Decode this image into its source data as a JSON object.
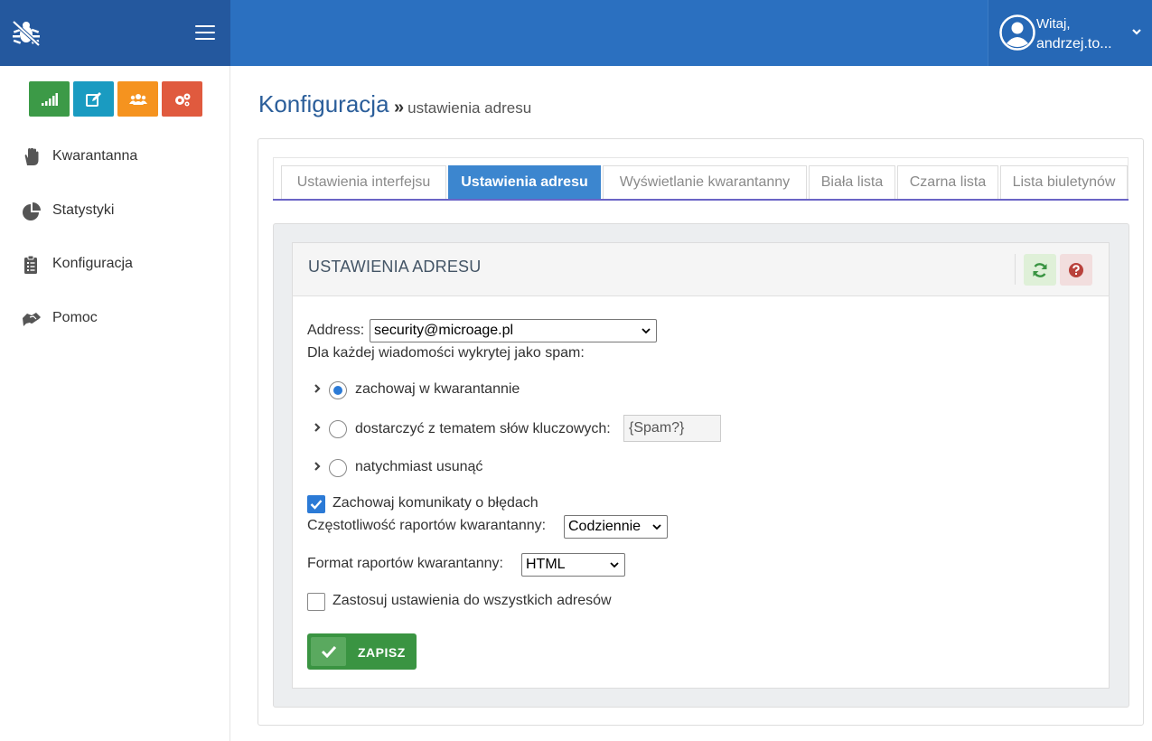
{
  "header": {
    "brand_icon": "bug-off-icon",
    "menu_icon": "hamburger-icon",
    "user": {
      "greeting": "Witaj,",
      "name": "andrzej.to...",
      "avatar_icon": "user-circle-icon",
      "caret_icon": "chevron-down-icon"
    }
  },
  "sidebar": {
    "quick_buttons": [
      {
        "icon": "signal-bars-icon",
        "color": "#3c9a47"
      },
      {
        "icon": "edit-icon",
        "color": "#1a9bc1"
      },
      {
        "icon": "users-icon",
        "color": "#f5931f"
      },
      {
        "icon": "cogs-icon",
        "color": "#e05a3e"
      }
    ],
    "items": [
      {
        "label": "Kwarantanna",
        "icon": "hand-icon"
      },
      {
        "label": "Statystyki",
        "icon": "pie-chart-icon"
      },
      {
        "label": "Konfiguracja",
        "icon": "clipboard-icon"
      },
      {
        "label": "Pomoc",
        "icon": "handshake-icon"
      }
    ]
  },
  "page": {
    "title": "Konfiguracja",
    "separator": "»",
    "subtitle": "ustawienia adresu"
  },
  "tabs": [
    {
      "label": "Ustawienia interfejsu",
      "active": false
    },
    {
      "label": "Ustawienia adresu",
      "active": true
    },
    {
      "label": "Wyświetlanie kwarantanny",
      "active": false
    },
    {
      "label": "Biała lista",
      "active": false
    },
    {
      "label": "Czarna lista",
      "active": false
    },
    {
      "label": "Lista biuletynów",
      "active": false
    }
  ],
  "panel": {
    "title": "USTAWIENIA ADRESU",
    "refresh_icon": "refresh-icon",
    "help_icon": "question-circle-icon"
  },
  "form": {
    "address_label": "Address:",
    "address_value": "security@microage.pl",
    "spam_label": "Dla każdej wiadomości wykrytej jako spam:",
    "options": [
      {
        "label": "zachowaj w kwarantannie",
        "selected": true
      },
      {
        "label": "dostarczyć z tematem słów kluczowych:",
        "selected": false
      },
      {
        "label": "natychmiast usunąć",
        "selected": false
      }
    ],
    "keyword_value": "{Spam?}",
    "keep_errors_label": "Zachowaj komunikaty o błędach",
    "keep_errors_checked": true,
    "frequency_label": "Częstotliwość raportów kwarantanny:",
    "frequency_value": "Codziennie",
    "format_label": "Format raportów kwarantanny:",
    "format_value": "HTML",
    "apply_all_label": "Zastosuj ustawienia do wszystkich adresów",
    "apply_all_checked": false,
    "save_label": "ZAPISZ",
    "save_icon": "check-icon"
  },
  "colors": {
    "topbar": "#2b70c0",
    "brand": "#24589e",
    "active_tab": "#3c86cf",
    "save": "#3a9442",
    "accent_line": "#6b64c6"
  }
}
